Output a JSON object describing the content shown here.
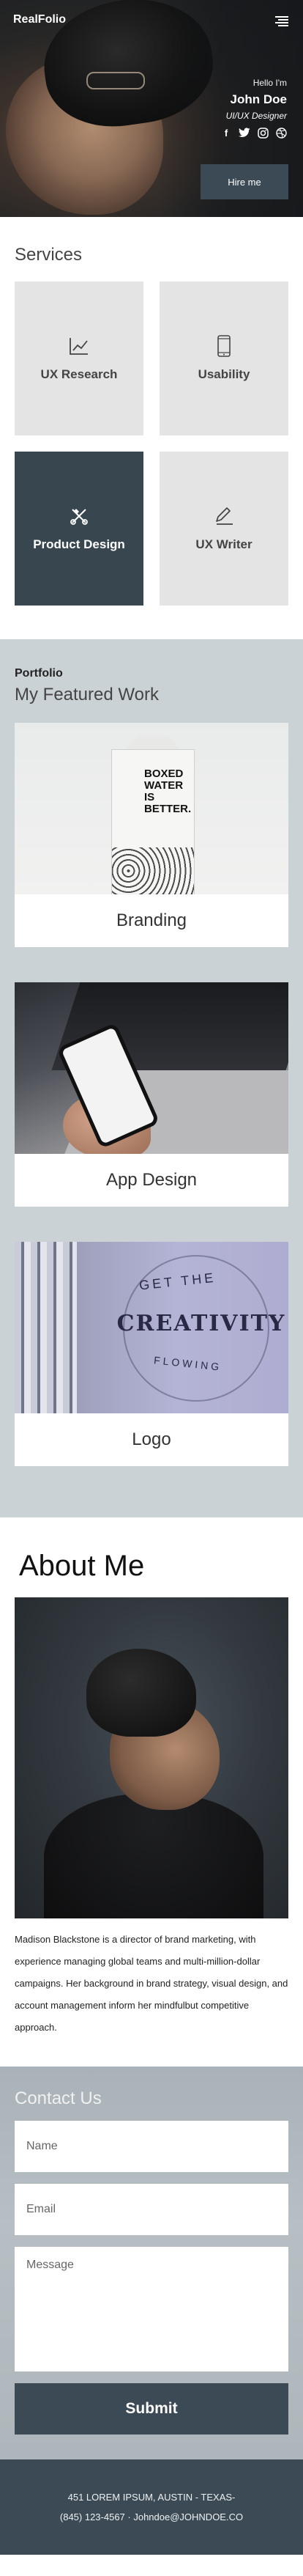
{
  "header": {
    "brand": "RealFolio",
    "menu_icon": "hamburger-menu-icon"
  },
  "hero": {
    "greeting": "Hello I'm",
    "name": "John Doe",
    "role": "UI/UX Designer",
    "socials": [
      {
        "icon": "facebook-icon",
        "glyph": "f"
      },
      {
        "icon": "twitter-icon",
        "glyph": "𝕥"
      },
      {
        "icon": "instagram-icon",
        "glyph": "◎"
      },
      {
        "icon": "dribbble-icon",
        "glyph": "⊛"
      }
    ],
    "cta_label": "Hire me"
  },
  "services": {
    "title": "Services",
    "items": [
      {
        "label": "UX Research",
        "icon": "line-chart-icon",
        "active": false
      },
      {
        "label": "Usability",
        "icon": "smartphone-icon",
        "active": false
      },
      {
        "label": "Product Design",
        "icon": "scissors-pen-tools-icon",
        "active": true
      },
      {
        "label": "UX Writer",
        "icon": "pencil-icon",
        "active": false
      }
    ]
  },
  "portfolio": {
    "eyebrow": "Portfolio",
    "title": "My Featured Work",
    "items": [
      {
        "label": "Branding",
        "image_text": "BOXED WATER IS BETTER."
      },
      {
        "label": "App Design"
      },
      {
        "label": "Logo",
        "image_text_top": "GET THE",
        "image_text_main": "CREATIVITY",
        "image_text_bottom": "FLOWING"
      }
    ]
  },
  "about": {
    "title": "About Me",
    "bio": "Madison Blackstone is a director of brand marketing, with experience managing global teams and multi-million-dollar campaigns. Her background in brand strategy, visual design, and account management inform her mindfulbut competitive approach."
  },
  "contact": {
    "title": "Contact Us",
    "name_placeholder": "Name",
    "email_placeholder": "Email",
    "message_placeholder": "Message",
    "submit_label": "Submit"
  },
  "footer": {
    "address": "451 LOREM IPSUM, AUSTIN - TEXAS-",
    "contact": "(845) 123-4567 · Johndoe@JOHNDOE.CO"
  },
  "colors": {
    "accent": "#3b4a54",
    "portfolio_bg": "#cbd2d6",
    "service_tile": "#e4e4e4"
  }
}
